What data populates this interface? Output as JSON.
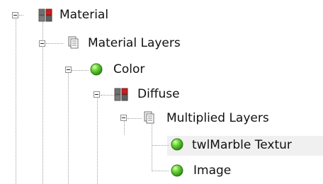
{
  "tree": {
    "material": {
      "label": "Material",
      "icon": "material-icon"
    },
    "material_layers": {
      "label": "Material Layers",
      "icon": "layers-icon"
    },
    "color": {
      "label": "Color",
      "icon": "color-sphere-icon"
    },
    "diffuse": {
      "label": "Diffuse",
      "icon": "diffuse-icon"
    },
    "multiplied_layers": {
      "label": "Multiplied Layers",
      "icon": "layers-icon"
    },
    "marble_texture": {
      "label": "twlMarble Textur",
      "icon": "texture-sphere-icon"
    },
    "image": {
      "label": "Image",
      "icon": "image-sphere-icon"
    }
  },
  "colors": {
    "tree_line": "#a0a0a0",
    "toggle_border": "#8f8f8f",
    "sphere_green": "#45b81c",
    "material_red": "#c61f1f",
    "material_gray": "#6f6f6f"
  }
}
